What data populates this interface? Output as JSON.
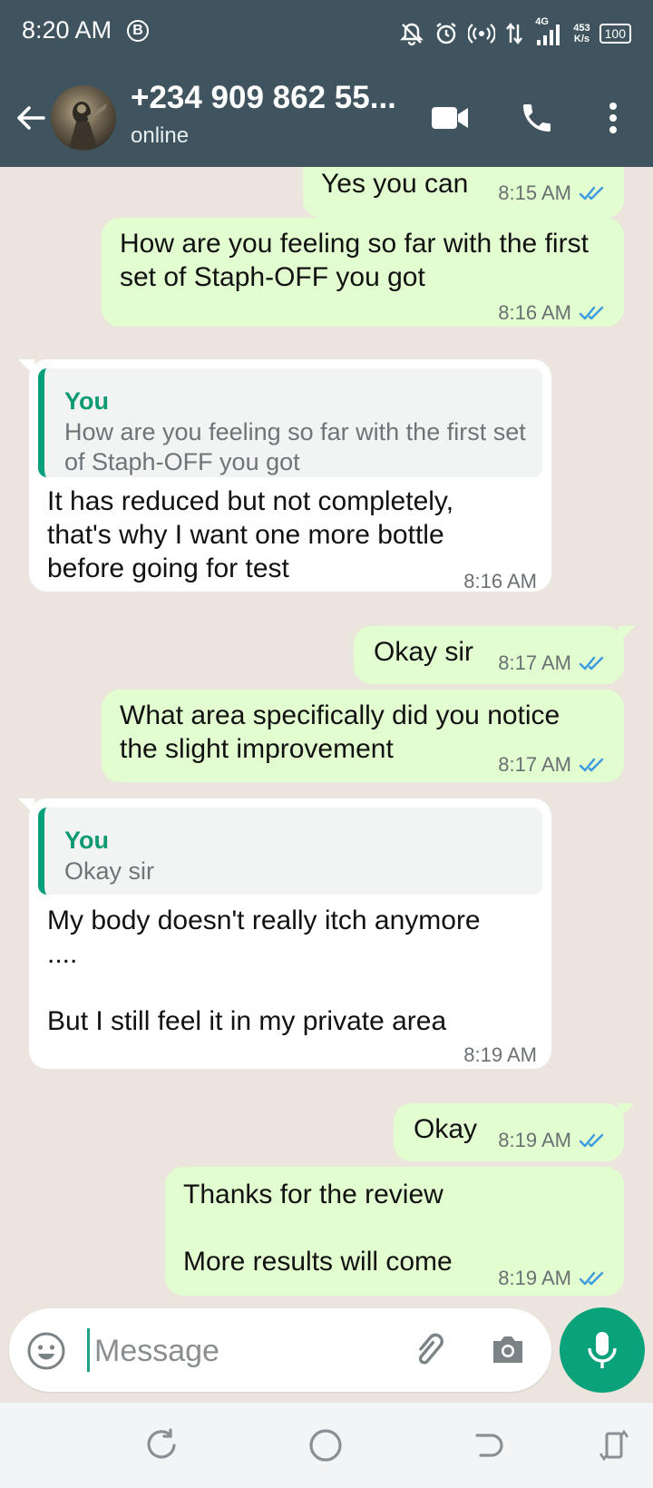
{
  "status_bar": {
    "time": "8:20 AM",
    "b_badge": "B",
    "network": "4G",
    "speed_value": "453",
    "speed_unit": "K/s",
    "battery": "100"
  },
  "header": {
    "contact_name": "+234 909 862 55...",
    "contact_status": "online"
  },
  "messages": [
    {
      "dir": "out",
      "text": "Yes you can",
      "time": "8:15 AM",
      "ticks": "read"
    },
    {
      "dir": "out",
      "text": "How are you feeling so far with the first set of Staph-OFF you got",
      "time": "8:16 AM",
      "ticks": "read"
    },
    {
      "dir": "in",
      "quote_author": "You",
      "quote_text": "How are you feeling so far with the first set of Staph-OFF you got",
      "text": "It has reduced but not completely, that's why I want one more bottle before going for test",
      "time": "8:16 AM"
    },
    {
      "dir": "out",
      "text": "Okay sir",
      "time": "8:17 AM",
      "ticks": "read"
    },
    {
      "dir": "out",
      "text": "What area specifically did you notice the slight improvement",
      "time": "8:17 AM",
      "ticks": "read"
    },
    {
      "dir": "in",
      "quote_author": "You",
      "quote_text": "Okay sir",
      "text": "My body doesn't really itch anymore ....\n\nBut I still feel it in my private area",
      "time": "8:19 AM"
    },
    {
      "dir": "out",
      "text": "Okay",
      "time": "8:19 AM",
      "ticks": "read"
    },
    {
      "dir": "out",
      "text": "Thanks for the review\n\nMore results will come",
      "time": "8:19 AM",
      "ticks": "read"
    }
  ],
  "composer": {
    "placeholder": "Message"
  },
  "colors": {
    "header": "#3f545e",
    "outgoing_bubble": "#e2fdd0",
    "incoming_bubble": "#ffffff",
    "accent": "#0aa27a",
    "read_ticks": "#3a9be0"
  }
}
